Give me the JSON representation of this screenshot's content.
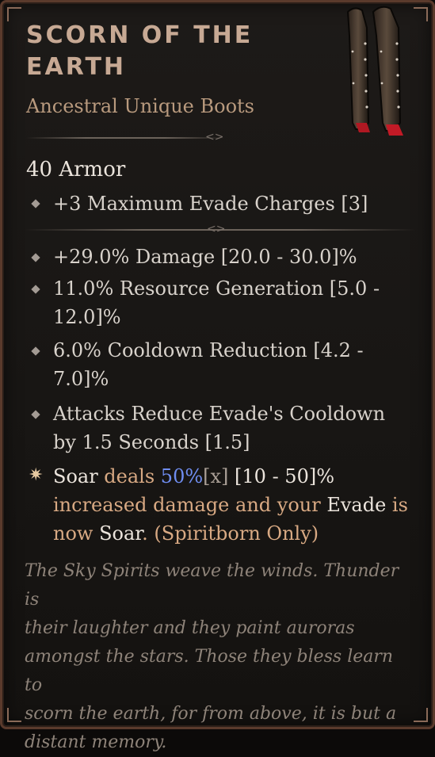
{
  "item": {
    "name_line1": "SCORN OF THE",
    "name_line2": "EARTH",
    "type": "Ancestral Unique Boots",
    "armor": "40 Armor"
  },
  "implicit": "+3 Maximum Evade Charges [3]",
  "affixes": [
    {
      "line1": "+29.0% Damage [20.0 - 30.0]%"
    },
    {
      "line1": "11.0% Resource Generation [5.0 -",
      "line2": "12.0]%"
    },
    {
      "line1": "6.0% Cooldown Reduction [4.2 -",
      "line2": "7.0]%"
    },
    {
      "line1": "Attacks Reduce Evade's Cooldown",
      "line2": "by 1.5 Seconds [1.5]"
    }
  ],
  "unique_power": {
    "skill": "Soar",
    "text1": " deals ",
    "value": "50%",
    "bracket": "[x]",
    "range": " [10 - 50]%",
    "text2": "increased damage and your ",
    "evade": "Evade",
    "text3": " is",
    "text4": "now ",
    "skill2": "Soar",
    "text5": ". ",
    "class_only": "(Spiritborn Only)"
  },
  "flavor": [
    "The Sky Spirits weave the winds. Thunder is",
    "their laughter and they paint auroras",
    "amongst the stars. Those they bless learn to",
    "scorn the earth, for from above, it is but a",
    "distant memory."
  ],
  "colors": {
    "title": "#c7a994",
    "unique_text": "#d8a983",
    "value_blue": "#6f8df0",
    "flavor": "#8e8379"
  },
  "icons": {
    "item_image": "boots-icon",
    "affix_bullet": "diamond-bullet-icon",
    "unique_bullet": "star-bullet-icon"
  }
}
